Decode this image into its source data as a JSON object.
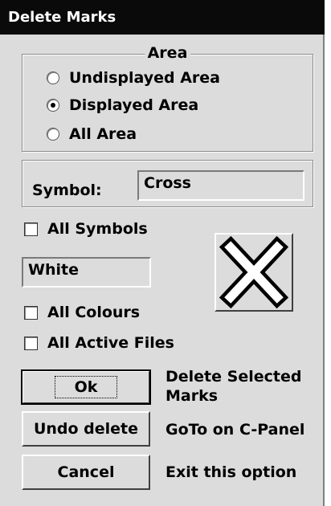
{
  "window": {
    "title": "Delete Marks"
  },
  "area": {
    "legend": "Area",
    "options": [
      {
        "label": "Undisplayed Area",
        "checked": false
      },
      {
        "label": "Displayed Area",
        "checked": true
      },
      {
        "label": "All Area",
        "checked": false
      }
    ]
  },
  "symbol": {
    "label": "Symbol:",
    "value": "Cross",
    "preview_icon": "cross-marker-icon"
  },
  "all_symbols": {
    "label": "All Symbols",
    "checked": false
  },
  "colour": {
    "value": "White"
  },
  "all_colours": {
    "label": "All Colours",
    "checked": false
  },
  "all_active_files": {
    "label": "All Active Files",
    "checked": false
  },
  "buttons": {
    "ok": {
      "label": "Ok",
      "description_line1": "Delete Selected",
      "description_line2": "Marks"
    },
    "undo": {
      "label": "Undo delete",
      "description": "GoTo on C-Panel"
    },
    "cancel": {
      "label": "Cancel",
      "description": "Exit this option"
    }
  }
}
